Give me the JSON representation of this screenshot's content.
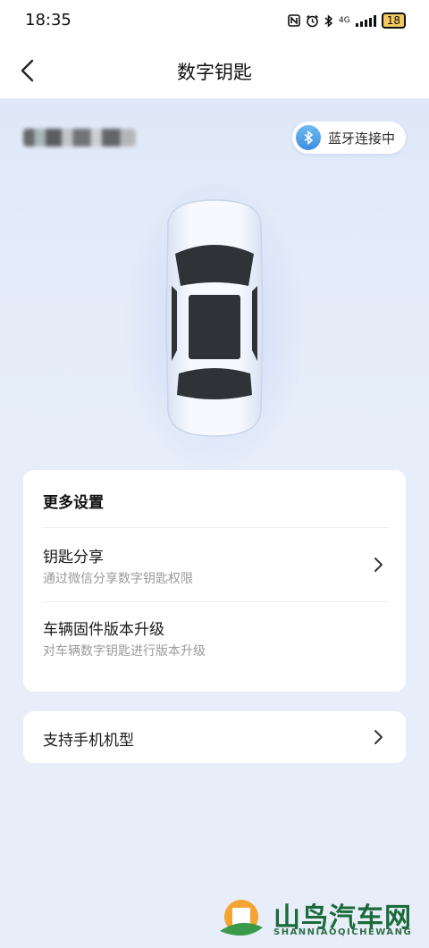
{
  "status_bar": {
    "time": "18:35",
    "icons": [
      "nfc-icon",
      "alarm-icon",
      "bluetooth-icon",
      "signal-icon"
    ],
    "network_text": "4G",
    "battery": "18"
  },
  "nav": {
    "title": "数字钥匙",
    "back_icon": "chevron-left-icon"
  },
  "hero": {
    "bluetooth_status": "蓝牙连接中",
    "accent_color": "#3c8fe0"
  },
  "settings": {
    "title": "更多设置",
    "items": [
      {
        "title": "钥匙分享",
        "subtitle": "通过微信分享数字钥匙权限",
        "has_chevron": true
      },
      {
        "title": "车辆固件版本升级",
        "subtitle": "对车辆数字钥匙进行版本升级",
        "has_chevron": false
      }
    ]
  },
  "support": {
    "title": "支持手机机型"
  },
  "watermark": {
    "name": "山鸟汽车网",
    "pinyin": "SHANNIAOQICHEWANG"
  }
}
